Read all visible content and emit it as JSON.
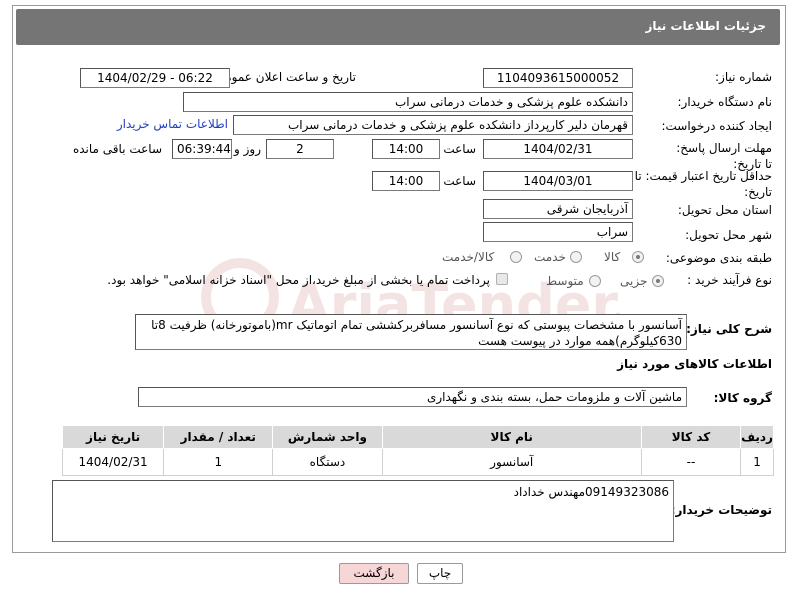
{
  "panel": {
    "title": "جزئیات اطلاعات نیاز"
  },
  "form": {
    "need_number_label": "شماره نیاز:",
    "need_number": "1104093615000052",
    "announce_label": "تاریخ و ساعت اعلان عمومی:",
    "announce_value": "1404/02/29 - 06:22",
    "buyer_org_label": "نام دستگاه خریدار:",
    "buyer_org": "دانشکده علوم پزشکی و خدمات درمانی سراب",
    "creator_label": "ایجاد کننده درخواست:",
    "creator": "قهرمان دلیر کارپرداز دانشکده علوم پزشکی و خدمات درمانی سراب",
    "contact_link": "اطلاعات تماس خریدار",
    "deadline_label": "مهلت ارسال پاسخ: تا تاریخ:",
    "deadline_date": "1404/02/31",
    "time_label": "ساعت",
    "deadline_time": "14:00",
    "days_value": "2",
    "days_label": "روز و",
    "remaining_value": "06:39:44",
    "remaining_label": "ساعت باقی مانده",
    "validity_label": "حداقل تاریخ اعتبار قیمت: تا تاریخ:",
    "validity_date": "1404/03/01",
    "validity_time": "14:00",
    "province_label": "استان محل تحویل:",
    "province": "آذربایجان شرقی",
    "city_label": "شهر محل تحویل:",
    "city": "سراب",
    "category_label": "طبقه بندی موضوعی:",
    "category_options": [
      "کالا",
      "خدمت",
      "کالا/خدمت"
    ],
    "category_selected": "کالا",
    "process_label": "نوع فرآیند خرید :",
    "process_options": [
      "جزیی",
      "متوسط"
    ],
    "process_selected": "جزیی",
    "treasury_note": "پرداخت تمام یا بخشی از مبلغ خرید،از محل \"اسناد خزانه اسلامی\" خواهد بود.",
    "description_label": "شرح کلی نیاز:",
    "description": "آسانسور با مشخصات پیوستی که نوع آسانسور مسافربرکششی تمام اتوماتیک mr(باموتورخانه) ظرفیت 8تا 630کیلوگرم)همه موارد در پیوست هست"
  },
  "goods": {
    "section_title": "اطلاعات کالاهای مورد نیاز",
    "group_label": "گروه کالا:",
    "group_value": "ماشین آلات و ملزومات حمل، بسته بندی و نگهداری",
    "columns": [
      "ردیف",
      "کد کالا",
      "نام کالا",
      "واحد شمارش",
      "تعداد / مقدار",
      "تاریخ نیاز"
    ],
    "rows": [
      [
        "1",
        "--",
        "آسانسور",
        "دستگاه",
        "1",
        "1404/02/31"
      ]
    ]
  },
  "buyer_notes": {
    "label": "توضیحات خریدار:",
    "value": "09149323086مهندس خداداد"
  },
  "buttons": {
    "print": "چاپ",
    "back": "بازگشت"
  },
  "watermark": {
    "text": "AriaTender.neT"
  },
  "colors": {
    "panel_header": "#757575",
    "link": "#1f3fbf",
    "back_button": "#f6d6d6"
  }
}
